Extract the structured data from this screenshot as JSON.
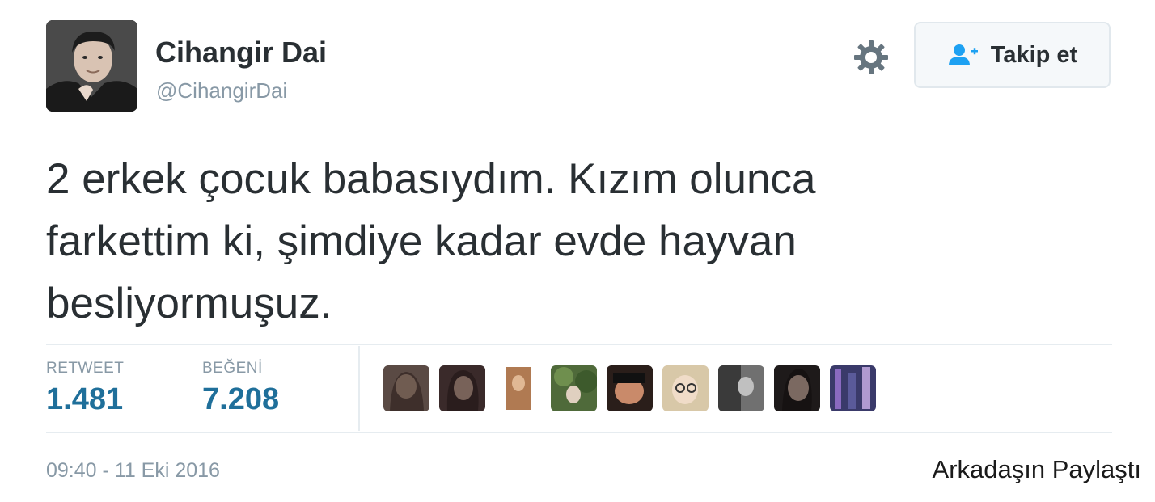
{
  "author": {
    "display_name": "Cihangir Dai",
    "handle": "@CihangirDai"
  },
  "header": {
    "settings_icon": "gear-icon",
    "follow_button": {
      "label": "Takip et",
      "icon": "add-user-icon"
    }
  },
  "tweet": {
    "lines": [
      "2 erkek çocuk babasıydım. Kızım olunca",
      "farkettim ki, şimdiye kadar evde hayvan",
      "besliyormuşuz."
    ]
  },
  "stats": {
    "retweet": {
      "label": "RETWEET",
      "value": "1.481"
    },
    "likes": {
      "label": "BEĞENİ",
      "value": "7.208"
    }
  },
  "likers_count_shown": 9,
  "timestamp": "09:40 - 11 Eki 2016",
  "overlay_text": "Arkadaşın Paylaştı",
  "colors": {
    "text_primary": "#292f33",
    "text_secondary": "#8899a6",
    "stat_value": "#1f6f9a",
    "follow_icon": "#1da1f2",
    "button_background": "#f5f8fa",
    "divider": "#e6ecf0"
  }
}
